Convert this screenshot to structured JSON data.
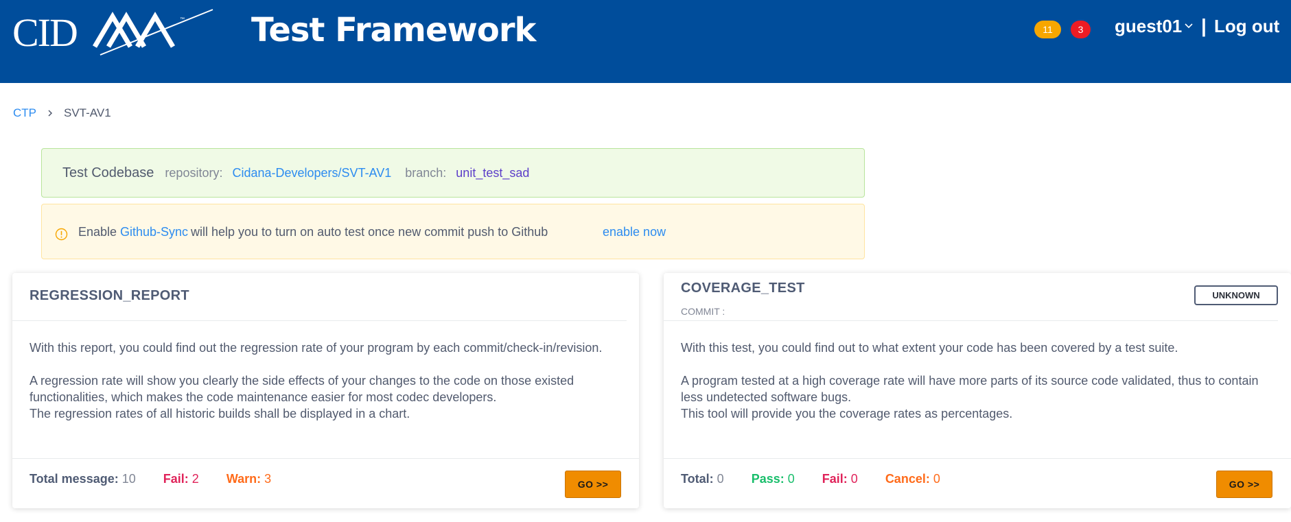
{
  "header": {
    "brand": "CIDANA",
    "app_title": "Test Framework",
    "badge_warnings": "11",
    "badge_errors": "3",
    "user_name": "guest01",
    "separator": "|",
    "logout_label": "Log out"
  },
  "breadcrumb": {
    "root": "CTP",
    "current": "SVT-AV1"
  },
  "codebase": {
    "title": "Test Codebase",
    "repository_label": "repository:",
    "repository": "Cidana-Developers/SVT-AV1",
    "branch_label": "branch:",
    "branch": "unit_test_sad"
  },
  "github_sync": {
    "prefix": "Enable",
    "link": "Github-Sync",
    "message": "will help you to turn on auto test once new commit push to Github",
    "action": "enable now"
  },
  "cards": [
    {
      "title": "REGRESSION_REPORT",
      "paragraphs": [
        "With this report, you could find out the regression rate of your program by each commit/check-in/revision.",
        "A regression rate will show you clearly the side effects of your changes to the code on those existed functionalities, which makes the code maintenance easier for most codec developers.",
        "The regression rates of all historic builds shall be displayed in a chart."
      ],
      "stats": [
        {
          "label": "Total message:",
          "value": "10"
        },
        {
          "label": "Fail:",
          "value": "2"
        },
        {
          "label": "Warn:",
          "value": "3"
        }
      ],
      "go_label": "GO >>"
    },
    {
      "title": "COVERAGE_TEST",
      "commit_label": "COMMIT :",
      "status": "UNKNOWN",
      "paragraphs": [
        "With this test, you could find out to what extent your code has been covered by a test suite.",
        "A program tested at a high coverage rate will have more parts of its source code validated, thus to contain less undetected software bugs.",
        "This tool will provide you the coverage rates as percentages."
      ],
      "stats": [
        {
          "label": "Total:",
          "value": "0"
        },
        {
          "label": "Pass:",
          "value": "0"
        },
        {
          "label": "Fail:",
          "value": "0"
        },
        {
          "label": "Cancel:",
          "value": "0"
        }
      ],
      "go_label": "GO >>"
    }
  ],
  "colors": {
    "header_bg": "#004d9b",
    "link": "#2d8cf0",
    "badge_warn": "#f7a600",
    "badge_error": "#ed1c24",
    "go_button": "#f08c00"
  },
  "icons": {
    "logo": "cidana-logo",
    "user_menu": "chevron-down-icon",
    "breadcrumb_sep": "chevron-right-icon",
    "alert": "info-circle-icon"
  }
}
